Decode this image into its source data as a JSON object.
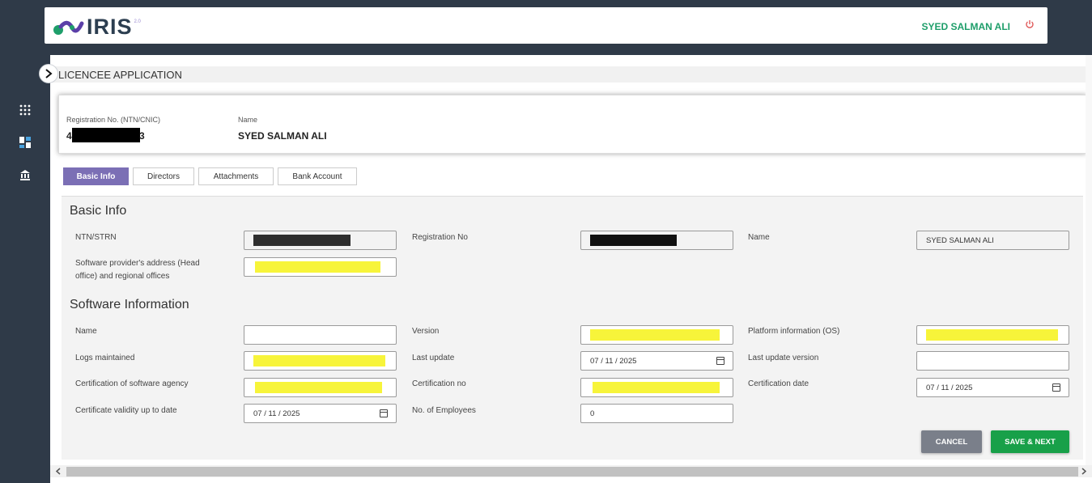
{
  "header": {
    "logo_text": "IRIS",
    "logo_version": "2.0",
    "user_name": "SYED SALMAN ALI"
  },
  "sidebar": {
    "icons": [
      "apps-grid-icon",
      "dashboard-icon",
      "building-icon"
    ]
  },
  "page": {
    "title": "LICENCEE APPLICATION"
  },
  "registration": {
    "reg_label": "Registration No. (NTN/CNIC)",
    "reg_value_prefix": "4",
    "reg_value_suffix": "3",
    "name_label": "Name",
    "name_value": "SYED SALMAN ALI"
  },
  "tabs": [
    {
      "label": "Basic Info",
      "active": true
    },
    {
      "label": "Directors",
      "active": false
    },
    {
      "label": "Attachments",
      "active": false
    },
    {
      "label": "Bank Account",
      "active": false
    }
  ],
  "basic_info": {
    "title": "Basic Info",
    "ntn_label": "NTN/STRN",
    "reg_no_label": "Registration No",
    "name_label": "Name",
    "name_value": "SYED SALMAN ALI",
    "address_label": "Software provider's address (Head office) and regional offices"
  },
  "software_info": {
    "title": "Software Information",
    "name_label": "Name",
    "name_value": "",
    "version_label": "Version",
    "platform_label": "Platform information (OS)",
    "logs_label": "Logs maintained",
    "last_update_label": "Last update",
    "last_update_value": "07 / 11 / 2025",
    "last_update_version_label": "Last update version",
    "last_update_version_value": "",
    "cert_agency_label": "Certification of software agency",
    "cert_no_label": "Certification no",
    "cert_date_label": "Certification date",
    "cert_date_value": "07 / 11 / 2025",
    "validity_label": "Certificate validity up to date",
    "validity_value": "07 / 11 / 2025",
    "employees_label": "No. of Employees",
    "employees_value": "0"
  },
  "buttons": {
    "cancel": "CANCEL",
    "save_next": "SAVE & NEXT"
  },
  "colors": {
    "brand_green": "#1e9e6a",
    "tab_active": "#7b6fb5",
    "save": "#18a049",
    "cancel": "#7a7f8a",
    "redaction_yellow": "#f7f43a"
  }
}
